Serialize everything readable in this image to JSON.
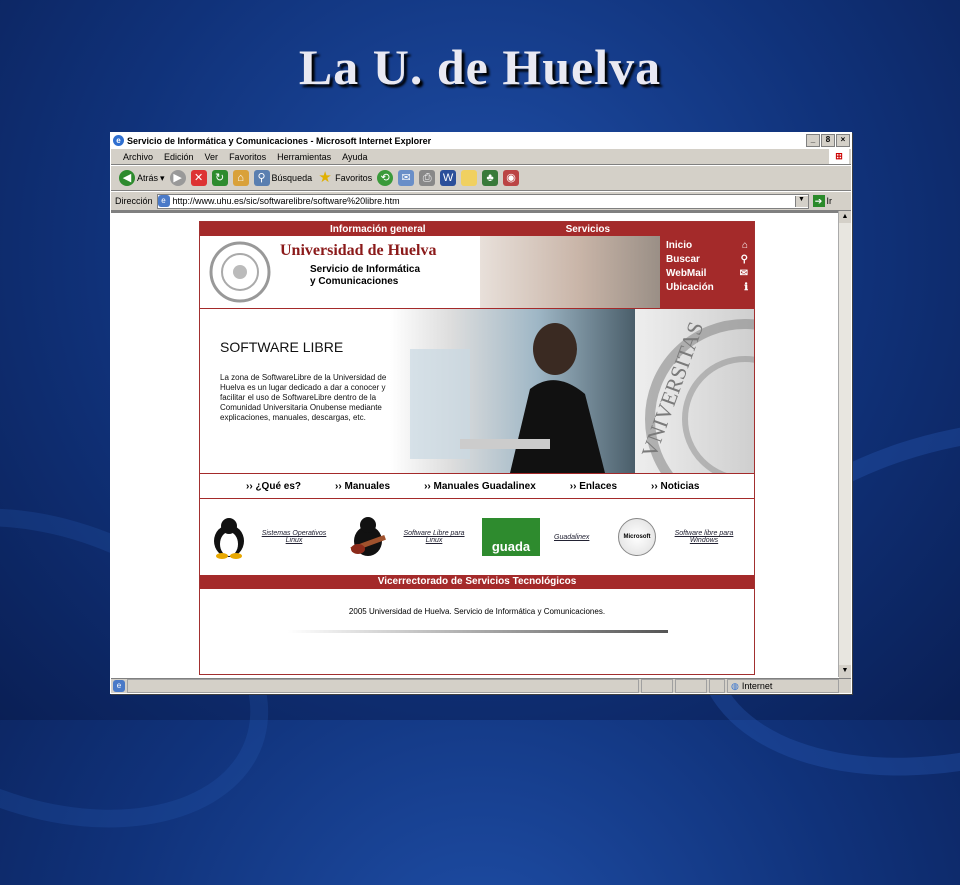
{
  "slide": {
    "title": "La U. de Huelva"
  },
  "window": {
    "title": "Servicio de Informática y Comunicaciones - Microsoft Internet Explorer",
    "controls": [
      "_",
      "8",
      "×"
    ]
  },
  "menubar": {
    "items": [
      "Archivo",
      "Edición",
      "Ver",
      "Favoritos",
      "Herramientas",
      "Ayuda"
    ]
  },
  "toolbar": {
    "back": "Atrás",
    "search": "Búsqueda",
    "favorites": "Favoritos"
  },
  "addressbar": {
    "label": "Dirección",
    "url": "http://www.uhu.es/sic/softwarelibre/software%20libre.htm",
    "go": "Ir"
  },
  "page": {
    "top_nav": {
      "info": "Información general",
      "services": "Servicios"
    },
    "header": {
      "university": "Universidad de Huelva",
      "service_line1": "Servicio de Informática",
      "service_line2": "y Comunicaciones"
    },
    "side_nav": [
      {
        "label": "Inicio",
        "icon": "home-icon",
        "glyph": "⌂"
      },
      {
        "label": "Buscar",
        "icon": "search-icon",
        "glyph": "⚲"
      },
      {
        "label": "WebMail",
        "icon": "mail-icon",
        "glyph": "✉"
      },
      {
        "label": "Ubicación",
        "icon": "info-icon",
        "glyph": "ℹ"
      }
    ],
    "hero": {
      "title": "SOFTWARE LIBRE",
      "text": "La zona de SoftwareLibre de la Universidad de Huelva es un lugar dedicado a dar a conocer y facilitar el uso de SoftwareLibre dentro de la Comunidad Universitaria Onubense mediante explicaciones, manuales, descargas, etc.",
      "seal_text": "VNIVERSITAS"
    },
    "menu": [
      "¿Qué es?",
      "Manuales",
      "Manuales Guadalinex",
      "Enlaces",
      "Noticias"
    ],
    "links": [
      {
        "label": "Sistemas Operativos Linux",
        "icon": "tux-penguin-icon"
      },
      {
        "label": "Software Libre para Linux",
        "icon": "tux-guitar-icon"
      },
      {
        "label": "Guadalinex",
        "icon": "guadalinex-logo-icon",
        "logo_text": "guada"
      },
      {
        "label": "Software libre para Windows",
        "icon": "microsoft-logo-icon",
        "logo_text": "Microsoft"
      }
    ],
    "footer_bar": "Vicerrectorado de Servicios Tecnológicos",
    "copyright": "2005 Universidad de Huelva. Servicio de Informática y Comunicaciones."
  },
  "statusbar": {
    "zone": "Internet"
  }
}
